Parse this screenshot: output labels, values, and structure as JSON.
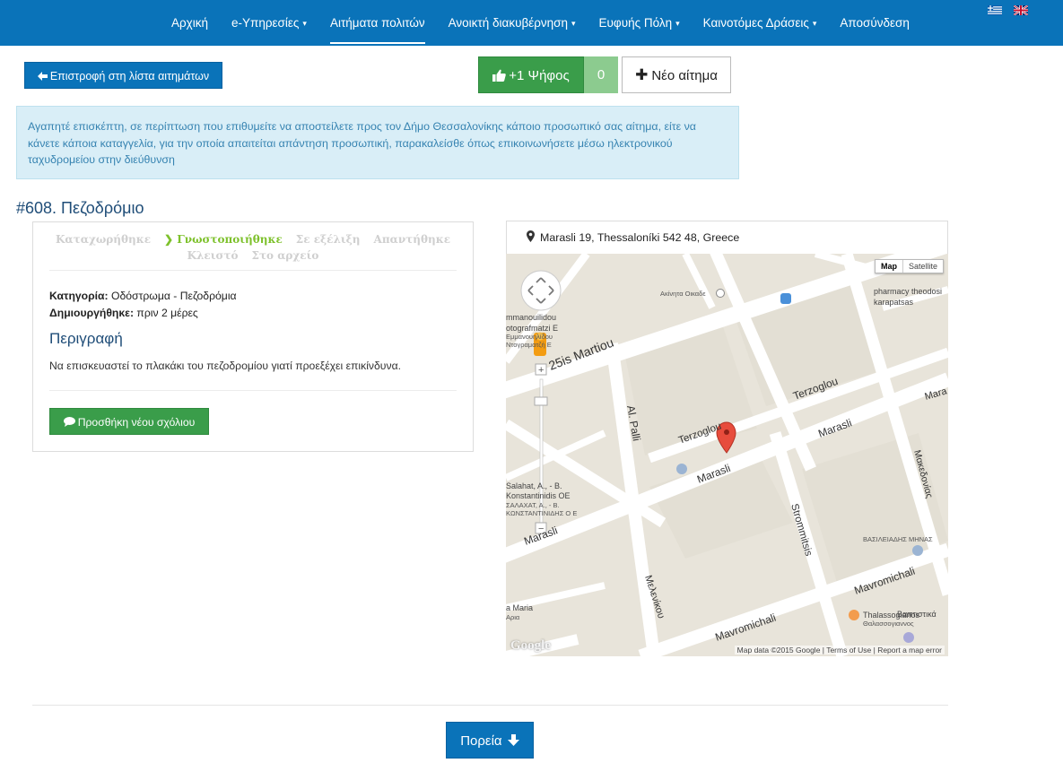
{
  "nav": {
    "items": [
      {
        "label": "Αρχική",
        "dropdown": false,
        "active": false
      },
      {
        "label": "e-Υπηρεσίες",
        "dropdown": true,
        "active": false
      },
      {
        "label": "Αιτήματα πολιτών",
        "dropdown": false,
        "active": true
      },
      {
        "label": "Ανοικτή διακυβέρνηση",
        "dropdown": true,
        "active": false
      },
      {
        "label": "Ευφυής Πόλη",
        "dropdown": true,
        "active": false
      },
      {
        "label": "Καινοτόμες Δράσεις",
        "dropdown": true,
        "active": false
      },
      {
        "label": "Αποσύνδεση",
        "dropdown": false,
        "active": false
      }
    ],
    "caret": "▾",
    "languages": [
      "greek-flag-icon",
      "uk-flag-icon"
    ]
  },
  "actions": {
    "back_label": "Επιστροφή στη λίστα αιτημάτων",
    "vote_label": "+1 Ψήφος",
    "vote_count": "0",
    "new_label": "Νέο αίτημα"
  },
  "alert": {
    "text": "Αγαπητέ επισκέπτη, σε περίπτωση που επιθυμείτε να αποστείλετε προς τον Δήμο Θεσσαλονίκης κάποιο προσωπικό σας αίτημα, είτε να κάνετε κάποια καταγγελία, για την οποία απαιτείται απάντηση προσωπική, παρακαλείσθε όπως επικοινωνήσετε μέσω ηλεκτρονικού ταχυδρομείου στην διεύθυνση"
  },
  "issue": {
    "title": "#608. Πεζοδρόμιο",
    "status_steps_row1": [
      "Καταχωρήθηκε",
      "Γνωστοποιήθηκε",
      "Σε εξέλιξη",
      "Απαντήθηκε"
    ],
    "status_steps_row2": [
      "Κλειστό",
      "Στο αρχείο"
    ],
    "active_step": "Γνωστοποιήθηκε",
    "category_label": "Κατηγορία:",
    "category_value": "Οδόστρωμα - Πεζοδρόμια",
    "created_label": "Δημιουργήθηκε:",
    "created_value": "πριν 2 μέρες",
    "description_heading": "Περιγραφή",
    "description_text": "Να επισκευαστεί το πλακάκι του πεζοδρομίου γιατί προεξέχει επικίνδυνα.",
    "comment_button": "Προσθήκη νέου σχόλιου"
  },
  "map": {
    "address": "Marasli 19, Thessaloníki 542 48, Greece",
    "type_map": "Map",
    "type_satellite": "Satellite",
    "attribution": "Map data ©2015 Google  |  Terms of Use  |  Report a map error",
    "logo": "Google",
    "labels": {
      "martiou": "25is Martiou",
      "palli": "Al. Palli",
      "terzoglou_a": "Terzoglou",
      "terzoglou_b": "Terzoglou",
      "marasli_a": "Marasli",
      "marasli_b": "Marasli",
      "marasli_c": "Marasli",
      "marasli_d": "Mara",
      "strommitsis": "Strommitsis",
      "mavromichali_a": "Mavromichali",
      "mavromichali_b": "Mavromichali",
      "melenikou": "Μελενίκου",
      "makedonias": "Μακεδονίας",
      "akinita": "Ακίνητα Οικαδε",
      "pharmacy1": "pharmacy theodosi",
      "pharmacy2": "karapatsas",
      "emmanouil1": "mmanouilidou",
      "emmanouil2": "otografmatzi E",
      "emmanouil3": "Εμμανουηλίδου",
      "emmanouil4": "Ντογραματζή Ε",
      "salahat1": "Salahat, A., - B.",
      "salahat2": "Konstantinidis OE",
      "salahat3": "ΣΑΛΑΧΑΤ, Α., - Β.",
      "salahat4": "ΚΩΝΣΤΑΝΤΙΝΙΔΗΣ Ο Ε",
      "vasileiadis": "ΒΑΣΙΛΕΙΑΔΗΣ ΜΗΝΑΣ",
      "thalassogianos1": "Thalassogianos",
      "thalassogianos2": "Θαλασσογιαννος",
      "vaptistika": "Βαπτιστικά",
      "maria": "a Maria",
      "mapia": "Αρια"
    }
  },
  "footer": {
    "poreia_label": "Πορεία"
  }
}
